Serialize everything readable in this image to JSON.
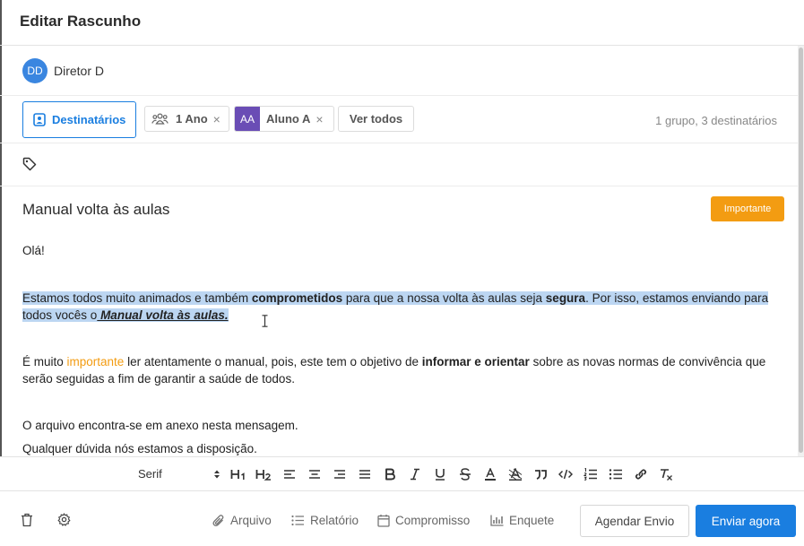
{
  "window": {
    "title": "Editar Rascunho"
  },
  "sender": {
    "initials": "DD",
    "name": "Diretor D"
  },
  "recipients": {
    "button_label": "Destinatários",
    "chips": [
      {
        "label": "1 Ano",
        "icon": "group-icon"
      },
      {
        "label": "Aluno A",
        "initials": "AA"
      }
    ],
    "see_all_label": "Ver todos",
    "summary": "1 grupo, 3 destinatários",
    "remove_glyph": "×"
  },
  "tags": {
    "icon": "tag-icon"
  },
  "message": {
    "subject": "Manual volta às aulas",
    "badge": "Importante",
    "greeting": "Olá!",
    "p1": {
      "a": "Estamos todos muito animados e também ",
      "b": "comprometidos",
      "c": " para que a nossa volta às aulas seja ",
      "d": "segura",
      "e": ". Por isso, estamos enviando para todos vocês o",
      "f": " Manual volta às aulas."
    },
    "p2": {
      "a": "É muito ",
      "b": "importante",
      "c": " ler atentamente o manual, pois, este tem o objetivo de ",
      "d": "informar e orientar",
      "e": " sobre as novas normas de convivência que serão seguidas a fim de garantir a saúde de todos."
    },
    "p3": "O arquivo encontra-se em anexo nesta mensagem.",
    "p4": "Qualquer dúvida nós estamos a disposição."
  },
  "toolbar": {
    "font": "Serif",
    "buttons": [
      "H1",
      "H2",
      "align-left",
      "align-center",
      "align-right",
      "justify",
      "bold",
      "italic",
      "underline",
      "strike",
      "text-color",
      "highlight",
      "quote",
      "code",
      "ordered-list",
      "bullet-list",
      "link",
      "clear-format"
    ]
  },
  "footer": {
    "arquivo": "Arquivo",
    "relatorio": "Relatório",
    "compromisso": "Compromisso",
    "enquete": "Enquete",
    "agendar": "Agendar Envio",
    "enviar": "Enviar agora"
  },
  "colors": {
    "accent": "#1a7ee0",
    "badge": "#f39c12",
    "aluno_avatar": "#6a4db5",
    "selection": "#bcd6f2"
  }
}
